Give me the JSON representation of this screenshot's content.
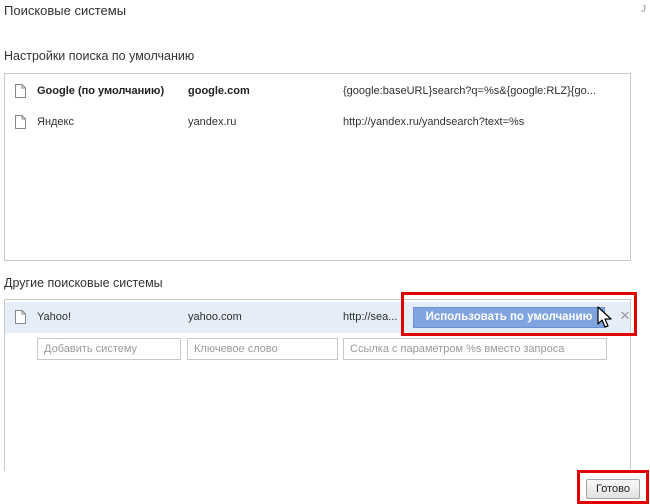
{
  "dialog": {
    "title": "Поисковые системы",
    "corner_mark": "J"
  },
  "default_section": {
    "label": "Настройки поиска по умолчанию",
    "engines": [
      {
        "name": "Google (по умолчанию)",
        "keyword": "google.com",
        "url": "{google:baseURL}search?q=%s&{google:RLZ}{go...",
        "bold": true
      },
      {
        "name": "Яндекс",
        "keyword": "yandex.ru",
        "url": "http://yandex.ru/yandsearch?text=%s",
        "bold": false
      }
    ]
  },
  "other_section": {
    "label": "Другие поисковые системы",
    "engines": [
      {
        "name": "Yahoo!",
        "keyword": "yahoo.com",
        "url": "http://sea..."
      }
    ],
    "make_default_button": "Использовать по умолчанию",
    "remove_icon": "close-icon"
  },
  "add_form": {
    "name_placeholder": "Добавить систему",
    "keyword_placeholder": "Ключевое слово",
    "url_placeholder": "Ссылка с параметром %s вместо запроса"
  },
  "footer": {
    "done_button": "Готово"
  },
  "colors": {
    "highlight": "#e00000",
    "selected_row": "#e5edf8",
    "default_button_bg": "#7fa4e0"
  }
}
